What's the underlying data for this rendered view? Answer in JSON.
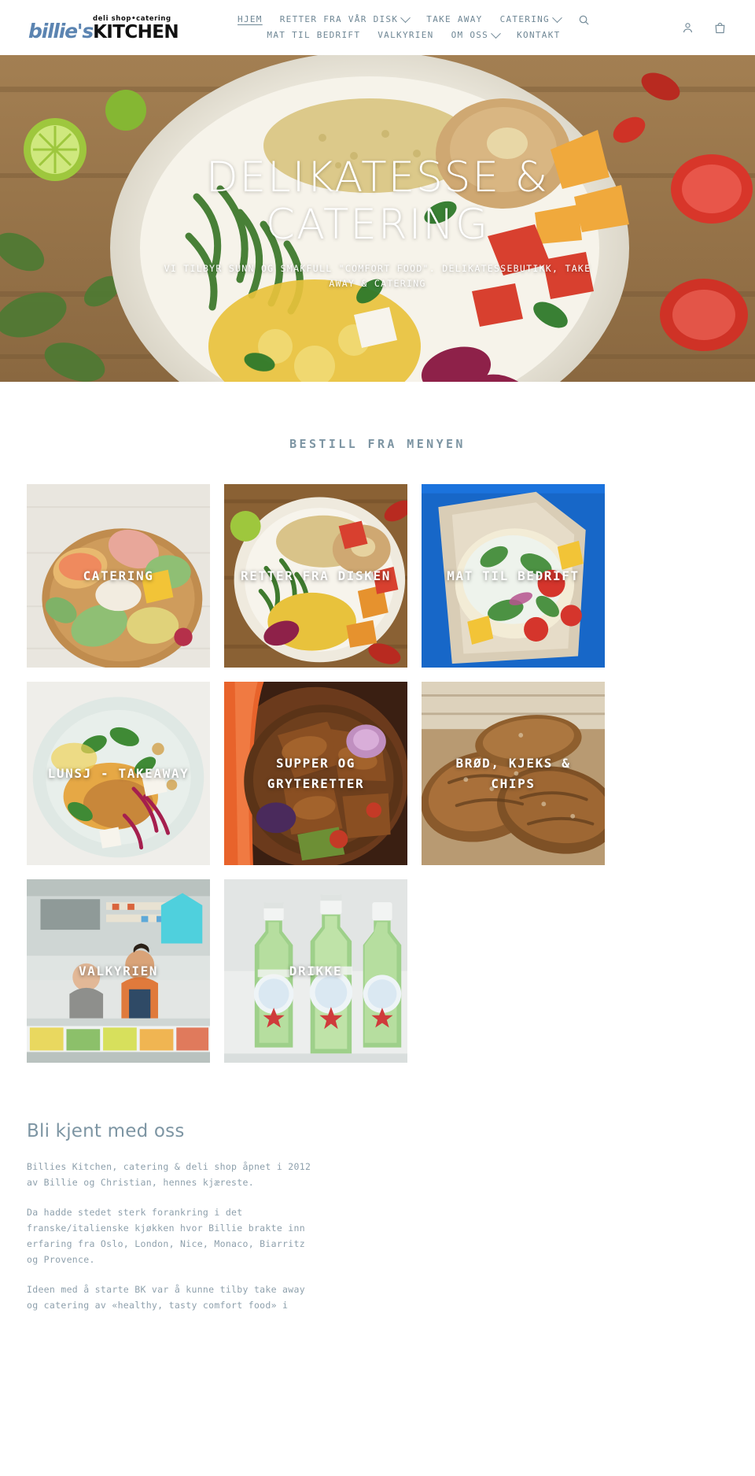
{
  "header": {
    "logo": {
      "tagline": "deli shop•catering",
      "name_1": "billie's",
      "name_2": "KITCHEN"
    },
    "nav_row_1": [
      {
        "label": "HJEM",
        "caret": false,
        "active": true,
        "name": "nav-hjem"
      },
      {
        "label": "RETTER FRA VÅR DISK",
        "caret": true,
        "active": false,
        "name": "nav-retter-fra-var-disk"
      },
      {
        "label": "TAKE AWAY",
        "caret": false,
        "active": false,
        "name": "nav-take-away"
      },
      {
        "label": "CATERING",
        "caret": true,
        "active": false,
        "name": "nav-catering"
      }
    ],
    "nav_row_2": [
      {
        "label": "MAT TIL BEDRIFT",
        "caret": false,
        "active": false,
        "name": "nav-mat-til-bedrift"
      },
      {
        "label": "VALKYRIEN",
        "caret": false,
        "active": false,
        "name": "nav-valkyrien"
      },
      {
        "label": "OM OSS",
        "caret": true,
        "active": false,
        "name": "nav-om-oss"
      },
      {
        "label": "KONTAKT",
        "caret": false,
        "active": false,
        "name": "nav-kontakt"
      }
    ],
    "icons": {
      "search": "search-icon",
      "account": "account-icon",
      "cart": "shopping-bag-icon"
    },
    "nav_color": "#6f8795",
    "accent_color": "#5b84b1"
  },
  "hero": {
    "title": "DELIKATESSE & CATERING",
    "subtitle": "VI TILBYR SUNN OG SMAKFULL \"COMFORT FOOD\". DELIKATESSEBUTIKK, TAKE AWAY & CATERING"
  },
  "menu": {
    "title": "BESTILL FRA MENYEN",
    "tiles": [
      {
        "label": "CATERING",
        "name": "menu-tile-catering"
      },
      {
        "label": "RETTER FRA DISKEN",
        "name": "menu-tile-retter-fra-disken"
      },
      {
        "label": "MAT TIL BEDRIFT",
        "name": "menu-tile-mat-til-bedrift"
      },
      {
        "label": "LUNSJ - TAKEAWAY",
        "name": "menu-tile-lunsj-takeaway"
      },
      {
        "label": "SUPPER OG GRYTERETTER",
        "name": "menu-tile-supper-og-gryteretter"
      },
      {
        "label": "BRØD, KJEKS & CHIPS",
        "name": "menu-tile-brod-kjeks-chips"
      },
      {
        "label": "VALKYRIEN",
        "name": "menu-tile-valkyrien"
      },
      {
        "label": "DRIKKE",
        "name": "menu-tile-drikke"
      }
    ]
  },
  "about": {
    "title": "Bli kjent med oss",
    "paragraph_1": "Billies Kitchen, catering & deli shop åpnet i 2012 av Billie og Christian, hennes kjæreste.",
    "paragraph_2": "Da hadde stedet sterk forankring i det franske/italienske kjøkken hvor Billie brakte inn erfaring fra Oslo, London, Nice, Monaco, Biarritz og Provence.",
    "paragraph_3": "Ideen med å starte BK var å kunne tilby take away og catering av «healthy, tasty comfort food» i"
  }
}
